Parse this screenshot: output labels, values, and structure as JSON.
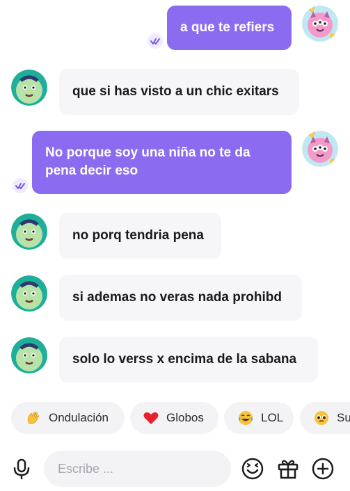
{
  "messages": [
    {
      "from": "me",
      "text": "a que te refiers"
    },
    {
      "from": "them",
      "text": "que si has visto a un chic exitars"
    },
    {
      "from": "me",
      "text": "No porque soy una niña no te da pena decir eso"
    },
    {
      "from": "them",
      "text": "no porq tendria pena"
    },
    {
      "from": "them",
      "text": "si ademas no veras nada prohibd"
    },
    {
      "from": "them",
      "text": "solo lo verss x encima de la sabana"
    }
  ],
  "quick_reactions": [
    {
      "label": "Ondulación",
      "icon": "waving-hand-icon"
    },
    {
      "label": "Globos",
      "icon": "red-heart-icon"
    },
    {
      "label": "LOL",
      "icon": "laughing-tears-icon"
    },
    {
      "label": "Su",
      "icon": "pleading-face-icon"
    }
  ],
  "composer": {
    "placeholder": "Escribe ..."
  },
  "colors": {
    "outgoing_bubble": "#8b6cf0",
    "incoming_bubble": "#f6f6f9",
    "chip_bg": "#f3f3f6"
  }
}
